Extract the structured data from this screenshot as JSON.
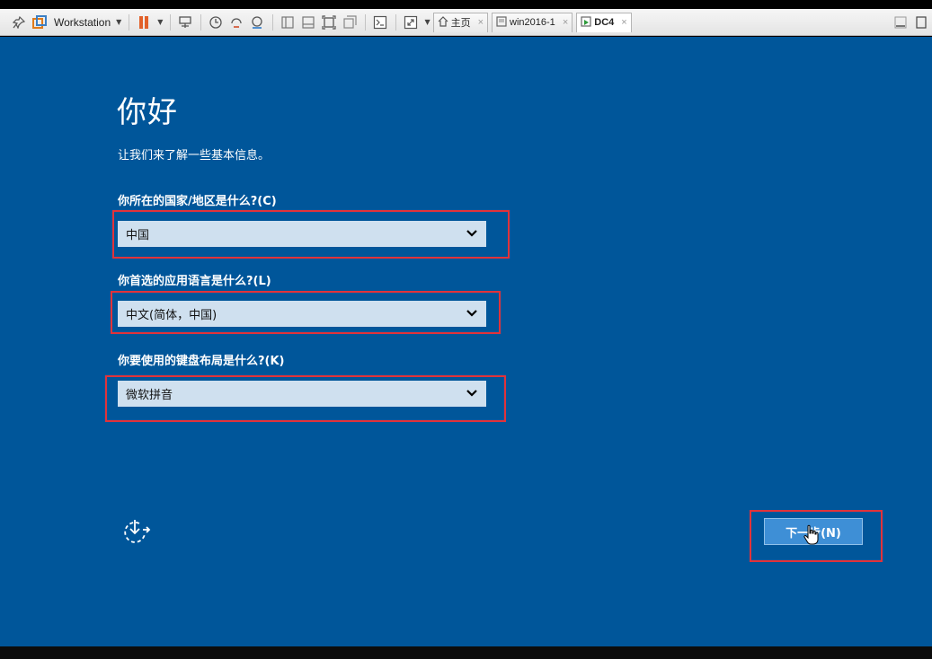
{
  "toolbar": {
    "product_label": "Workstation",
    "tabs": [
      {
        "label": "主页",
        "icon": "home-icon"
      },
      {
        "label": "win2016-1",
        "icon": "vm-icon"
      },
      {
        "label": "DC4",
        "icon": "vm-icon",
        "active": true
      }
    ],
    "close_glyph": "×"
  },
  "oobe": {
    "title": "你好",
    "subtitle": "让我们来了解一些基本信息。",
    "region_question": "你所在的国家/地区是什么?(C)",
    "region_value": "中国",
    "language_question": "你首选的应用语言是什么?(L)",
    "language_value": "中文(简体，中国)",
    "keyboard_question": "你要使用的键盘布局是什么?(K)",
    "keyboard_value": "微软拼音",
    "next_label": "下一步(N)"
  },
  "colors": {
    "background": "#00569a",
    "select_background": "#cfe0ef",
    "highlight_box": "#e2333a",
    "button": "#3e8fd6"
  },
  "icons": [
    "pin-icon",
    "vmware-logo-icon",
    "pause-icon",
    "send-ctrl-alt-del-icon",
    "snapshot-icon",
    "revert-snapshot-icon",
    "snapshot-manager-icon",
    "console-view-icon",
    "fullscreen-icon",
    "terminal-icon",
    "stretch-icon",
    "home-icon",
    "vm-icon",
    "chevron-down-icon",
    "accessibility-icon",
    "cursor-icon"
  ]
}
